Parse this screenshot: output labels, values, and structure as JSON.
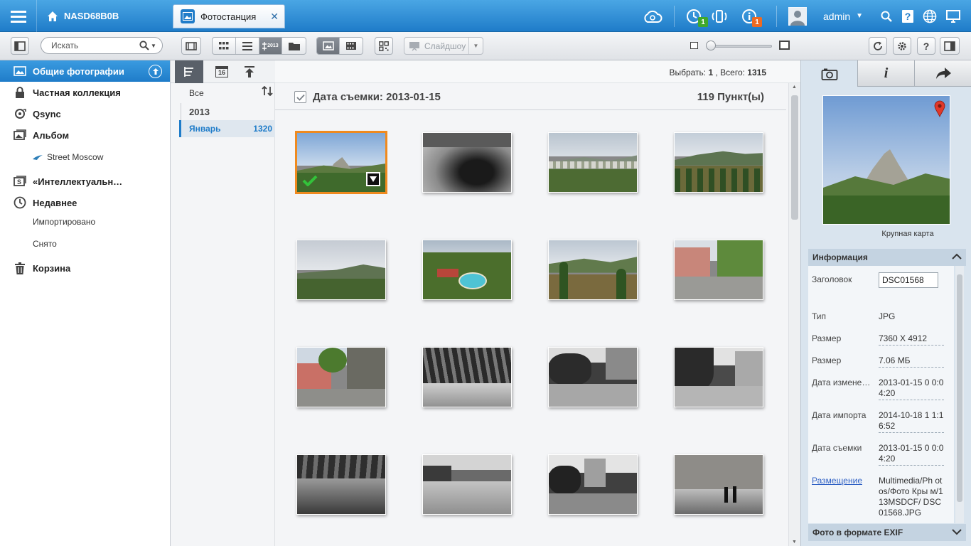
{
  "header": {
    "nas_name": "NASD68B0B",
    "app_tab_label": "Фотостанция",
    "user": "admin",
    "badges": {
      "tasks": "1",
      "info": "1"
    }
  },
  "toolbar": {
    "search_placeholder": "Искать",
    "slideshow_label": "Слайдшоу",
    "timeline_tag": "2013"
  },
  "sidebar": {
    "items": [
      {
        "label": "Общие фотографии",
        "icon": "photo-icon"
      },
      {
        "label": "Частная коллекция",
        "icon": "lock-icon"
      },
      {
        "label": "Qsync",
        "icon": "sync-icon"
      },
      {
        "label": "Альбом",
        "icon": "album-icon"
      },
      {
        "label": "Street Moscow",
        "icon": "bird-icon"
      },
      {
        "label": "«Интеллектуальн…",
        "icon": "smart-album-icon"
      },
      {
        "label": "Недавнее",
        "icon": "clock-icon"
      },
      {
        "label": "Импортировано",
        "icon": ""
      },
      {
        "label": "Снято",
        "icon": ""
      },
      {
        "label": "Корзина",
        "icon": "trash-icon"
      }
    ]
  },
  "tree": {
    "calendar_day": "16",
    "all_label": "Все",
    "year": "2013",
    "month": "Январь",
    "month_count": "1320"
  },
  "status": {
    "selected_label": "Выбрать:",
    "selected": "1",
    "total_label": ", Всего:",
    "total": "1315"
  },
  "group": {
    "title": "Дата съемки: 2013-01-15",
    "count": "119 Пункт(ы)"
  },
  "thumbnails": [
    {
      "scene": "mountain-rock",
      "selected": true
    },
    {
      "scene": "tunnel-bw"
    },
    {
      "scene": "town-valley"
    },
    {
      "scene": "forest-hills"
    },
    {
      "scene": "plain-hills"
    },
    {
      "scene": "resort-pool"
    },
    {
      "scene": "valley-fields"
    },
    {
      "scene": "street-house"
    },
    {
      "scene": "house-wall"
    },
    {
      "scene": "bw-shadows"
    },
    {
      "scene": "bw-street-rider"
    },
    {
      "scene": "bw-buildings"
    },
    {
      "scene": "bw-path"
    },
    {
      "scene": "bw-walker"
    },
    {
      "scene": "bw-city"
    },
    {
      "scene": "bw-people-wall"
    }
  ],
  "right_panel": {
    "big_map_label": "Крупная карта",
    "info_title": "Информация",
    "exif_title": "Фото в формате EXIF",
    "fields": {
      "title_label": "Заголовок",
      "title_value": "DSC01568",
      "type_label": "Тип",
      "type_value": "JPG",
      "size_label": "Размер",
      "dims_value": "7360 X 4912",
      "size2_label": "Размер",
      "filesize_value": "7.06 МБ",
      "modified_label": "Дата измене…",
      "modified_value": "2013-01-15 0 0:04:20",
      "imported_label": "Дата импорта",
      "imported_value": "2014-10-18 1 1:16:52",
      "taken_label": "Дата съемки",
      "taken_value": "2013-01-15 0 0:04:20",
      "location_label": "Размещение",
      "location_value": "Multimedia/Ph otos/Фото Кры м/113MSDCF/ DSC01568.JPG"
    }
  },
  "colors": {
    "header_top": "#4aa6e4",
    "header_bottom": "#1f7cc9",
    "accent": "#1f7cc9",
    "selection": "#ef8a1f",
    "badge_green": "#3fa82c",
    "badge_orange": "#ee6a22",
    "panel_bg": "#d9e4ee"
  }
}
